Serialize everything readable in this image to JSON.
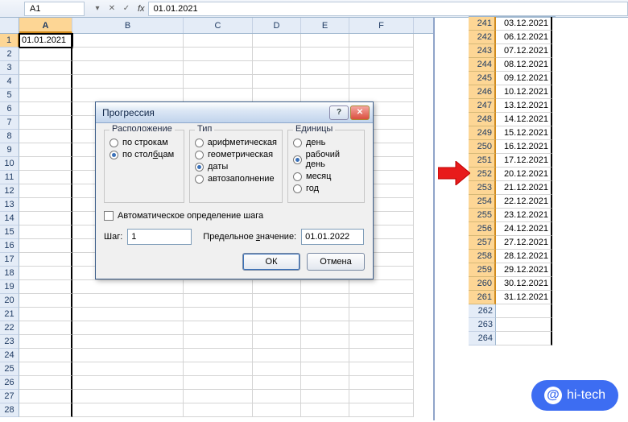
{
  "formula_bar": {
    "name_box": "A1",
    "formula": "01.01.2021"
  },
  "columns": [
    "A",
    "B",
    "C",
    "D",
    "E",
    "F"
  ],
  "rows": [
    1,
    2,
    3,
    4,
    5,
    6,
    7,
    8,
    9,
    10,
    11,
    12,
    13,
    14,
    15,
    16,
    17,
    18,
    19,
    20,
    21,
    22,
    23,
    24,
    25,
    26,
    27,
    28
  ],
  "cells": {
    "A1": "01.01.2021"
  },
  "dialog": {
    "title": "Прогрессия",
    "groups": {
      "layout_label": "Расположение",
      "layout_options": {
        "by_rows": "по строкам",
        "by_cols": "по столбцам"
      },
      "layout_selected": "by_cols",
      "type_label": "Тип",
      "type_options": {
        "arith": "арифметическая",
        "geom": "геометрическая",
        "dates": "даты",
        "autofill": "автозаполнение"
      },
      "type_selected": "dates",
      "units_label": "Единицы",
      "units_options": {
        "day": "день",
        "workday": "рабочий день",
        "month": "месяц",
        "year": "год"
      },
      "units_selected": "workday"
    },
    "auto_step_label": "Автоматическое определение шага",
    "step_label": "Шаг:",
    "step_value": "1",
    "limit_label": "Предельное значение:",
    "limit_value": "01.01.2022",
    "ok": "ОК",
    "cancel": "Отмена"
  },
  "result_rows": [
    {
      "n": 241,
      "d": "03.12.2021"
    },
    {
      "n": 242,
      "d": "06.12.2021"
    },
    {
      "n": 243,
      "d": "07.12.2021"
    },
    {
      "n": 244,
      "d": "08.12.2021"
    },
    {
      "n": 245,
      "d": "09.12.2021"
    },
    {
      "n": 246,
      "d": "10.12.2021"
    },
    {
      "n": 247,
      "d": "13.12.2021"
    },
    {
      "n": 248,
      "d": "14.12.2021"
    },
    {
      "n": 249,
      "d": "15.12.2021"
    },
    {
      "n": 250,
      "d": "16.12.2021"
    },
    {
      "n": 251,
      "d": "17.12.2021"
    },
    {
      "n": 252,
      "d": "20.12.2021"
    },
    {
      "n": 253,
      "d": "21.12.2021"
    },
    {
      "n": 254,
      "d": "22.12.2021"
    },
    {
      "n": 255,
      "d": "23.12.2021"
    },
    {
      "n": 256,
      "d": "24.12.2021"
    },
    {
      "n": 257,
      "d": "27.12.2021"
    },
    {
      "n": 258,
      "d": "28.12.2021"
    },
    {
      "n": 259,
      "d": "29.12.2021"
    },
    {
      "n": 260,
      "d": "30.12.2021"
    },
    {
      "n": 261,
      "d": "31.12.2021"
    },
    {
      "n": 262,
      "d": ""
    },
    {
      "n": 263,
      "d": ""
    },
    {
      "n": 264,
      "d": ""
    }
  ],
  "watermark": "hi-tech"
}
